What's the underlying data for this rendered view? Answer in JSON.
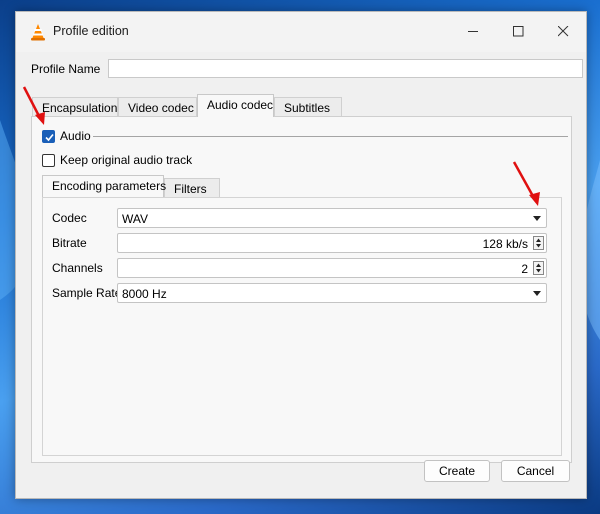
{
  "window": {
    "title": "Profile edition",
    "app_icon": "vlc-cone-icon",
    "controls": {
      "minimize": "minimize-icon",
      "maximize": "maximize-icon",
      "close": "close-icon"
    }
  },
  "profile": {
    "label": "Profile Name",
    "value": ""
  },
  "tabs": [
    {
      "label": "Encapsulation",
      "active": false
    },
    {
      "label": "Video codec",
      "active": false
    },
    {
      "label": "Audio codec",
      "active": true
    },
    {
      "label": "Subtitles",
      "active": false
    }
  ],
  "audio": {
    "checkbox_label": "Audio",
    "checked": true,
    "keep_original_label": "Keep original audio track",
    "keep_original_checked": false
  },
  "inner_tabs": [
    {
      "label": "Encoding parameters",
      "active": true
    },
    {
      "label": "Filters",
      "active": false
    }
  ],
  "fields": {
    "codec": {
      "label": "Codec",
      "value": "WAV"
    },
    "bitrate": {
      "label": "Bitrate",
      "value": "128 kb/s"
    },
    "channels": {
      "label": "Channels",
      "value": "2"
    },
    "sample_rate": {
      "label": "Sample Rate",
      "value": "8000 Hz"
    }
  },
  "buttons": {
    "create": "Create",
    "cancel": "Cancel"
  },
  "colors": {
    "accent": "#1a5fb8",
    "annotation": "#e01010"
  }
}
